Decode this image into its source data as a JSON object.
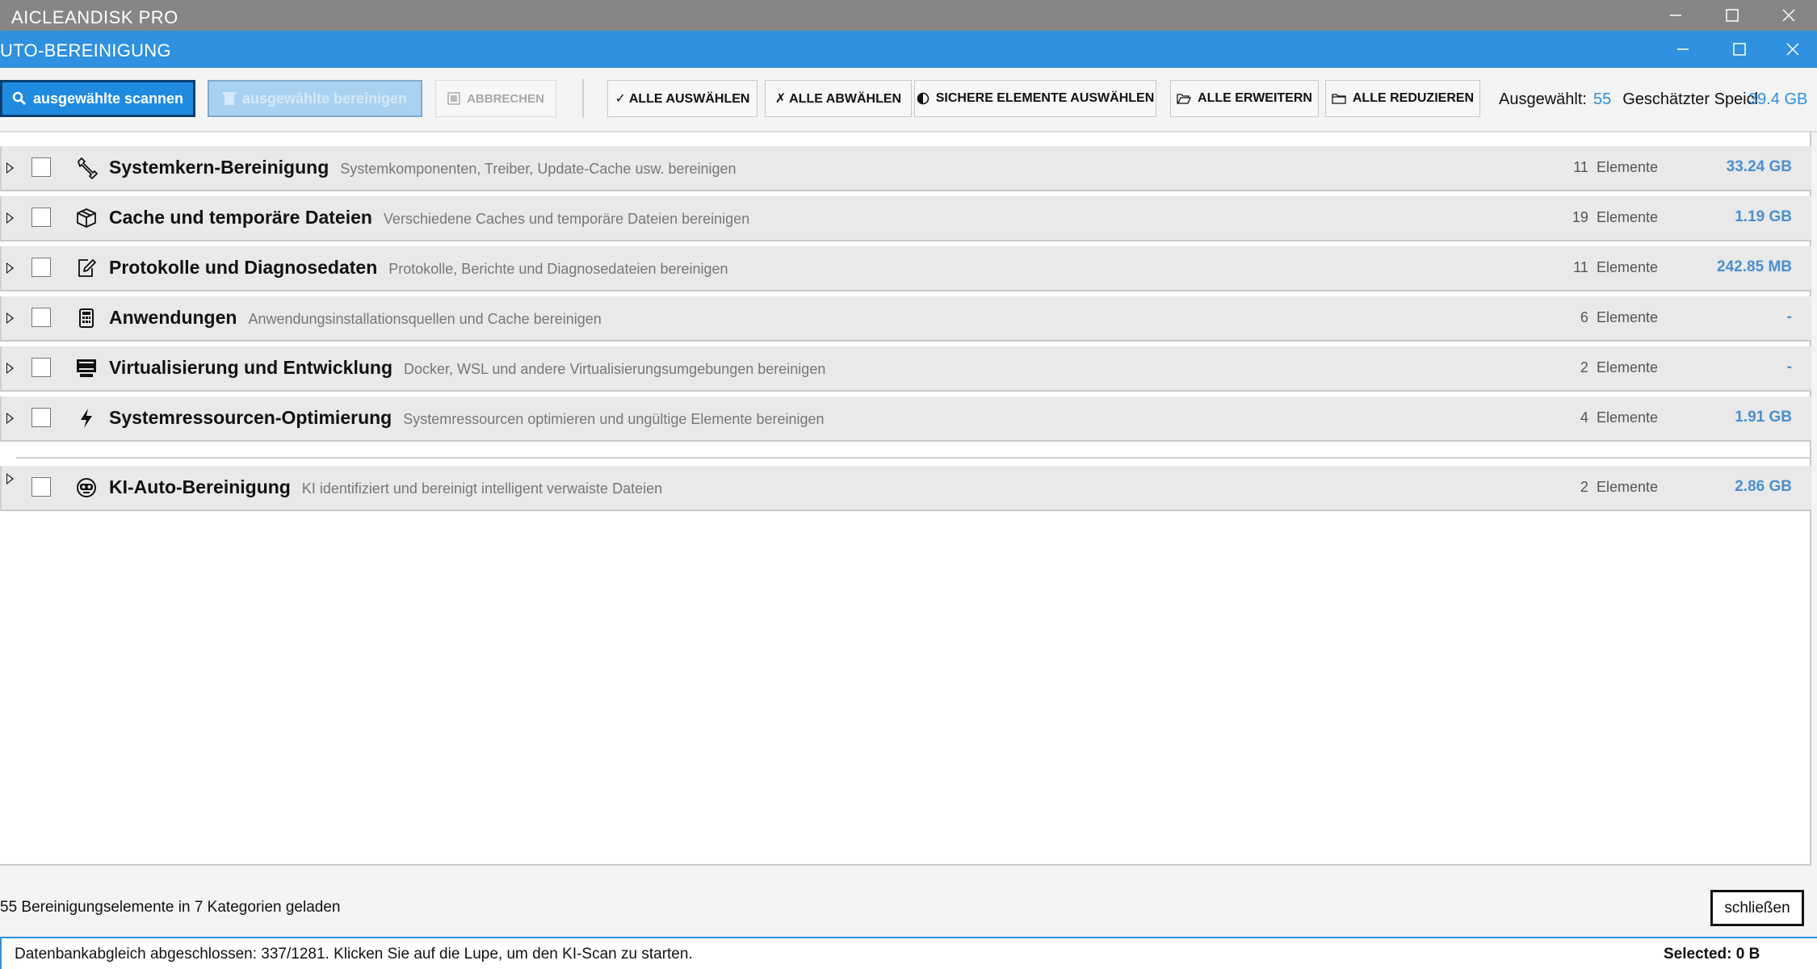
{
  "outer_window": {
    "title": "AICLEANDISK PRO"
  },
  "dialog": {
    "title": "UTO-BEREINIGUNG"
  },
  "toolbar": {
    "scan_label": "ausgewählte scannen",
    "clean_label": "ausgewählte bereinigen",
    "cancel_label": "ABBRECHEN",
    "select_all_label": "✓ ALLE AUSWÄHLEN",
    "deselect_all_label": "✗ ALLE ABWÄHLEN",
    "select_safe_label": "SICHERE ELEMENTE AUSWÄHLEN",
    "expand_all_label": "ALLE ERWEITERN",
    "collapse_all_label": "ALLE REDUZIEREN"
  },
  "summary": {
    "selected_label": "Ausgewählt:",
    "selected_count": "55",
    "estimated_label": "Geschätzter Speicl",
    "estimated_size": "39.4 GB"
  },
  "categories": [
    {
      "title": "Systemkern-Bereinigung",
      "description": "Systemkomponenten, Treiber, Update-Cache usw. bereinigen",
      "count": "11",
      "unit": "Elemente",
      "size": "33.24 GB",
      "icon": "wrench-icon"
    },
    {
      "title": "Cache und temporäre Dateien",
      "description": "Verschiedene Caches und temporäre Dateien bereinigen",
      "count": "19",
      "unit": "Elemente",
      "size": "1.19 GB",
      "icon": "box-icon"
    },
    {
      "title": "Protokolle und Diagnosedaten",
      "description": "Protokolle, Berichte und Diagnosedateien bereinigen",
      "count": "11",
      "unit": "Elemente",
      "size": "242.85 MB",
      "icon": "edit-document-icon"
    },
    {
      "title": "Anwendungen",
      "description": "Anwendungsinstallationsquellen und Cache bereinigen",
      "count": "6",
      "unit": "Elemente",
      "size": "-",
      "icon": "calculator-icon"
    },
    {
      "title": "Virtualisierung und Entwicklung",
      "description": "Docker, WSL und andere Virtualisierungsumgebungen bereinigen",
      "count": "2",
      "unit": "Elemente",
      "size": "-",
      "icon": "monitor-icon"
    },
    {
      "title": "Systemressourcen-Optimierung",
      "description": "Systemressourcen optimieren und ungültige Elemente bereinigen",
      "count": "4",
      "unit": "Elemente",
      "size": "1.91 GB",
      "icon": "lightning-icon"
    },
    {
      "title": "KI-Auto-Bereinigung",
      "description": "KI identifiziert und bereinigt intelligent verwaiste Dateien",
      "count": "2",
      "unit": "Elemente",
      "size": "2.86 GB",
      "icon": "robot-icon"
    }
  ],
  "footer": {
    "info": "55 Bereinigungselemente in 7 Kategorien geladen",
    "close_label": "schließen"
  },
  "statusbar": {
    "message": "Datenbankabgleich abgeschlossen: 337/1281. Klicken Sie auf die Lupe, um den KI-Scan zu starten.",
    "selected": "Selected: 0 B"
  }
}
